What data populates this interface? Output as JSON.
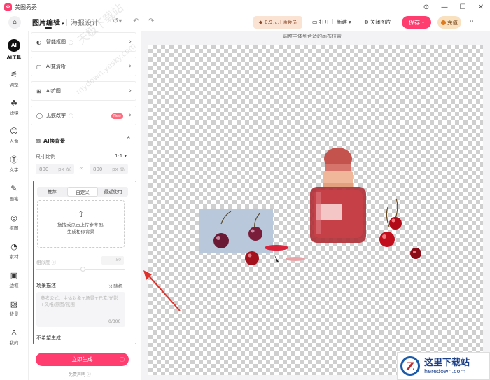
{
  "app": {
    "name": "美图秀秀",
    "logo_icon": "meitu-logo-icon"
  },
  "window_controls": {
    "pin": "⊙",
    "minimize": "—",
    "maximize": "☐",
    "close": "✕"
  },
  "toolbar": {
    "tab_edit": "图片编辑",
    "tab_poster": "海报设计",
    "vip_label": "0.9元开通会员",
    "open_label": "打开",
    "new_label": "新建",
    "close_image_label": "关闭图片",
    "save_label": "保存",
    "charge_label": "充值"
  },
  "leftnav": {
    "items": [
      {
        "label": "AI工具",
        "icon": "ai-icon",
        "glyph": "AI"
      },
      {
        "label": "调整",
        "icon": "sliders-icon",
        "glyph": "⚟"
      },
      {
        "label": "滤镜",
        "icon": "filter-icon",
        "glyph": "☘"
      },
      {
        "label": "人像",
        "icon": "portrait-icon",
        "glyph": "☺"
      },
      {
        "label": "文字",
        "icon": "text-icon",
        "glyph": "Ⓣ"
      },
      {
        "label": "画笔",
        "icon": "brush-icon",
        "glyph": "✎"
      },
      {
        "label": "抠图",
        "icon": "cutout-icon",
        "glyph": "◎"
      },
      {
        "label": "素材",
        "icon": "material-icon",
        "glyph": "◔"
      },
      {
        "label": "边框",
        "icon": "frame-icon",
        "glyph": "▣"
      },
      {
        "label": "背景",
        "icon": "background-icon",
        "glyph": "▨"
      },
      {
        "label": "我的",
        "icon": "user-icon",
        "glyph": "♙"
      }
    ]
  },
  "panel": {
    "features": [
      {
        "label": "智能抠图",
        "icon": "smart-cutout-icon",
        "glyph": "◐"
      },
      {
        "label": "AI变清晰",
        "icon": "enhance-icon",
        "glyph": "▢"
      },
      {
        "label": "AI扩图",
        "icon": "expand-icon",
        "glyph": "⊞"
      },
      {
        "label": "无痕改字",
        "icon": "erase-text-icon",
        "glyph": "◯",
        "badge": "New"
      }
    ],
    "ai_background": {
      "title": "AI换背景",
      "ratio_label": "尺寸比例",
      "ratio_value": "1:1",
      "width": "800",
      "height": "800",
      "unit": "px",
      "width_suffix": "宽",
      "height_suffix": "高",
      "tabs": [
        "推荐",
        "自定义",
        "最近使用"
      ],
      "upload_text_1": "拖拽或点击上传参考图,",
      "upload_text_2": "生成相似背景",
      "similarity_label": "相似度",
      "similarity_value": "50",
      "scene_label": "场景描述",
      "random_label": "随机",
      "scene_placeholder": "参考公式：主体对象+场景+元素/光影+风格/意图/氛围",
      "scene_count": "0/300",
      "negative_label": "不希望生成",
      "generate_label": "立即生成",
      "disclaimer": "免责声明"
    }
  },
  "canvas": {
    "hint": "调整主体到合适的画布位置"
  },
  "watermark": {
    "text_1": "天极下载站",
    "text_2": "mydown.yesky.com"
  },
  "badge": {
    "cn": "这里下载站",
    "en": "heredown.com",
    "logo": "Z"
  },
  "colors": {
    "accent": "#ff3d6e",
    "highlight_box": "#e0302a"
  }
}
